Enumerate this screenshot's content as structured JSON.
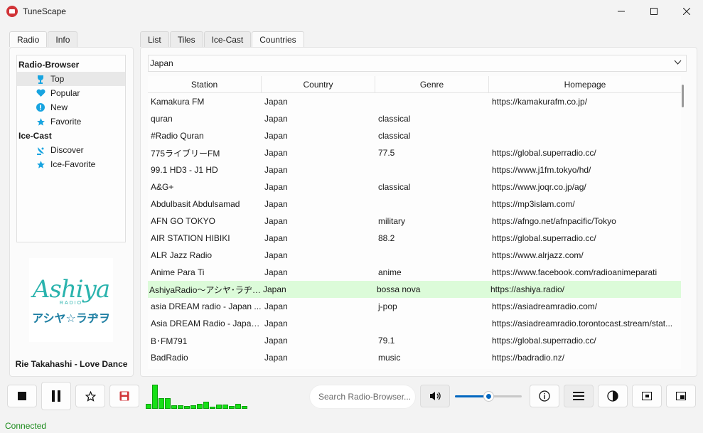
{
  "window": {
    "title": "TuneScape",
    "minimize": "—",
    "maximize": "☐",
    "close": "✕"
  },
  "left_tabs": [
    {
      "label": "Radio"
    },
    {
      "label": "Info"
    }
  ],
  "tree": {
    "groups": [
      {
        "label": "Radio-Browser",
        "items": [
          {
            "label": "Top",
            "icon": "trophy-icon"
          },
          {
            "label": "Popular",
            "icon": "heart-icon"
          },
          {
            "label": "New",
            "icon": "new-badge-icon"
          },
          {
            "label": "Favorite",
            "icon": "star-icon"
          }
        ]
      },
      {
        "label": "Ice-Cast",
        "items": [
          {
            "label": "Discover",
            "icon": "satellite-icon"
          },
          {
            "label": "Ice-Favorite",
            "icon": "star-icon"
          }
        ]
      }
    ]
  },
  "logo": {
    "main": "Ashiya",
    "sub": "RADIO",
    "kana": "アシヤ☆ラヂヲ"
  },
  "now_playing": "Rie Takahashi - Love Dance",
  "right_tabs": [
    {
      "label": "List"
    },
    {
      "label": "Tiles"
    },
    {
      "label": "Ice-Cast"
    },
    {
      "label": "Countries"
    }
  ],
  "country_select": {
    "value": "Japan"
  },
  "table": {
    "columns": [
      "Station",
      "Country",
      "Genre",
      "Homepage"
    ],
    "rows": [
      [
        "Kamakura FM",
        "Japan",
        "",
        "https://kamakurafm.co.jp/"
      ],
      [
        "quran",
        "Japan",
        "classical",
        ""
      ],
      [
        "#Radio Quran",
        "Japan",
        "classical",
        ""
      ],
      [
        "775ライブリーFM",
        "Japan",
        "77.5",
        "https://global.superradio.cc/"
      ],
      [
        "99.1 HD3 - J1 HD",
        "Japan",
        "",
        "https://www.j1fm.tokyo/hd/"
      ],
      [
        "A&G+",
        "Japan",
        "classical",
        "https://www.joqr.co.jp/ag/"
      ],
      [
        "Abdulbasit Abdulsamad",
        "Japan",
        "",
        "https://mp3islam.com/"
      ],
      [
        "AFN GO TOKYO",
        "Japan",
        "military",
        "https://afngo.net/afnpacific/Tokyo"
      ],
      [
        "AIR STATION HIBIKI",
        "Japan",
        "88.2",
        "https://global.superradio.cc/"
      ],
      [
        "ALR Jazz Radio",
        "Japan",
        "",
        "https://www.alrjazz.com/"
      ],
      [
        "Anime Para Ti",
        "Japan",
        "anime",
        "https://www.facebook.com/radioanimeparati"
      ],
      [
        "AshiyaRadio～アシヤ･ラヂヲ～",
        "Japan",
        "bossa nova",
        "https://ashiya.radio/"
      ],
      [
        "asia DREAM radio - Japan ...",
        "Japan",
        "j-pop",
        "https://asiadreamradio.com/"
      ],
      [
        "Asia DREAM Radio - Japan...",
        "Japan",
        "",
        "https://asiadreamradio.torontocast.stream/stat..."
      ],
      [
        "B･FM791",
        "Japan",
        "79.1",
        "https://global.superradio.cc/"
      ],
      [
        "BadRadio",
        "Japan",
        "music",
        "https://badradio.nz/"
      ]
    ],
    "highlighted_row": 11
  },
  "controls": {
    "stop": "stop-icon",
    "pause": "pause-icon",
    "favorite": "star-icon",
    "save": "save-icon",
    "search_placeholder": "Search Radio-Browser...",
    "volume_level": 0.5
  },
  "visualizer": [
    0.2,
    1.0,
    0.45,
    0.45,
    0.15,
    0.15,
    0.12,
    0.15,
    0.2,
    0.3,
    0.1,
    0.18,
    0.18,
    0.12,
    0.22,
    0.12
  ],
  "status": "Connected",
  "colors": {
    "accent": "#0067c0",
    "viz": "#16e016",
    "highlight": "#dcfbd9",
    "status": "#1a8a1a"
  }
}
